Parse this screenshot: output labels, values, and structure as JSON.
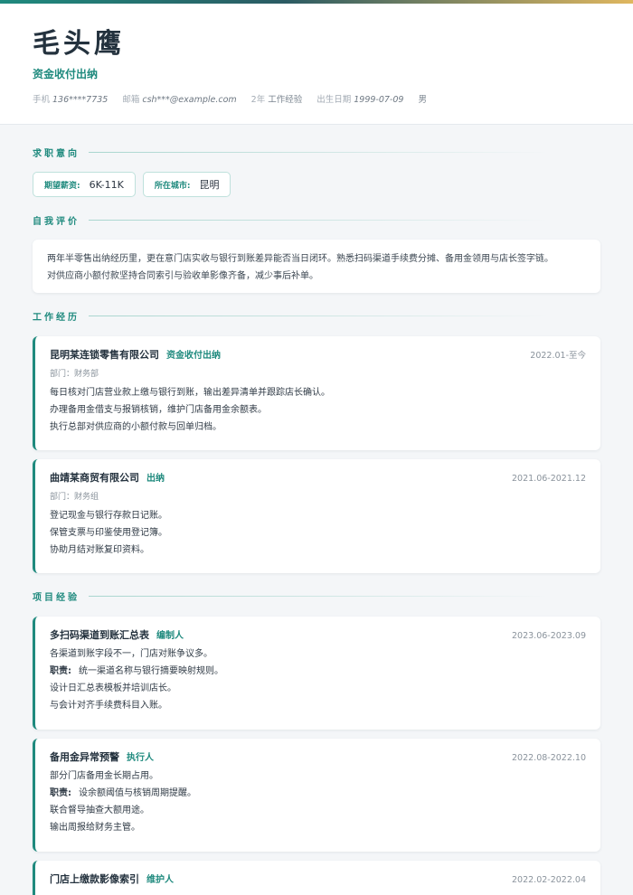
{
  "header": {
    "name": "毛头鹰",
    "title": "资金收付出纳",
    "contacts": {
      "phone_label": "手机",
      "phone": "136****7735",
      "email_label": "邮箱",
      "email": "csh***@example.com",
      "years": "2年",
      "years_label": "工作经验",
      "birth_label": "出生日期",
      "birth": "1999-07-09",
      "gender": "男"
    }
  },
  "sections": {
    "intent": "求职意向",
    "self": "自我评价",
    "work": "工作经历",
    "projects": "项目经验"
  },
  "intent": {
    "salary_label": "期望薪资:",
    "salary": "6K-11K",
    "city_label": "所在城市:",
    "city": "昆明"
  },
  "summary": [
    "两年半零售出纳经历里，更在意门店实收与银行到账差异能否当日闭环。熟悉扫码渠道手续费分摊、备用金领用与店长签字链。",
    "对供应商小额付款坚持合同索引与验收单影像齐备，减少事后补单。"
  ],
  "work": [
    {
      "org": "昆明某连锁零售有限公司",
      "role": "资金收付出纳",
      "date": "2022.01-至今",
      "dept": "部门：财务部",
      "lines": [
        "每日核对门店营业款上缴与银行到账，输出差异清单并跟踪店长确认。",
        "办理备用金借支与报销核销，维护门店备用金余额表。",
        "执行总部对供应商的小额付款与回单归档。"
      ]
    },
    {
      "org": "曲靖某商贸有限公司",
      "role": "出纳",
      "date": "2021.06-2021.12",
      "dept": "部门：财务组",
      "lines": [
        "登记现金与银行存款日记账。",
        "保管支票与印鉴使用登记簿。",
        "协助月结对账复印资料。"
      ]
    }
  ],
  "projects": [
    {
      "name": "多扫码渠道到账汇总表",
      "role": "编制人",
      "date": "2023.06-2023.09",
      "desc": "各渠道到账字段不一，门店对账争议多。",
      "duty_label": "职责:",
      "duty": "统一渠道名称与银行摘要映射规则。",
      "lines": [
        "设计日汇总表模板并培训店长。",
        "与会计对齐手续费科目入账。"
      ]
    },
    {
      "name": "备用金异常预警",
      "role": "执行人",
      "date": "2022.08-2022.10",
      "desc": "部分门店备用金长期占用。",
      "duty_label": "职责:",
      "duty": "设余额阈值与核销周期提醒。",
      "lines": [
        "联合督导抽查大额用途。",
        "输出周报给财务主管。"
      ]
    },
    {
      "name": "门店上缴款影像索引",
      "role": "维护人",
      "date": "2022.02-2022.04"
    }
  ],
  "colors": {
    "accent": "#1f8a7e",
    "heading": "#24323e",
    "background": "#f4f6f8"
  }
}
